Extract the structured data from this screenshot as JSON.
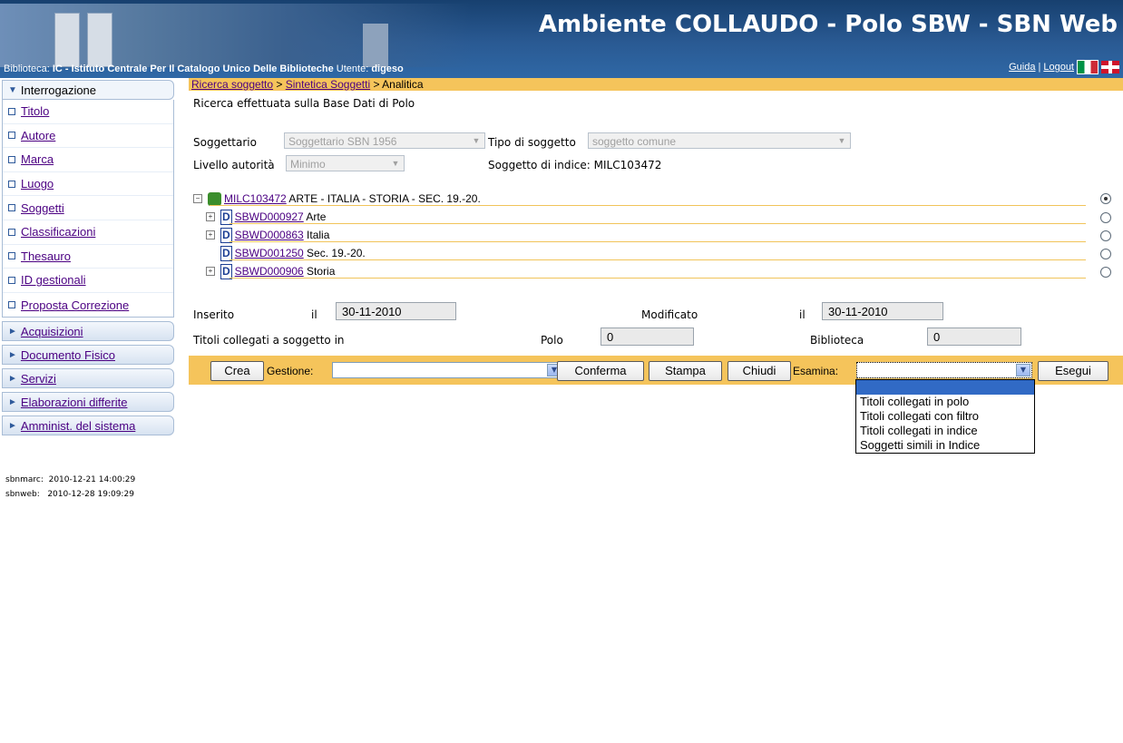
{
  "header": {
    "title": "Ambiente COLLAUDO - Polo SBW - SBN Web",
    "biblioteca_label": "Biblioteca:",
    "biblioteca_code": "IC",
    "biblioteca_name": " - Istituto Centrale Per Il Catalogo Unico Delle Biblioteche",
    "utente_label": "Utente:",
    "utente": "digeso",
    "guida": "Guida",
    "separator": "|",
    "logout": "Logout"
  },
  "sidebar": {
    "open_section": "Interrogazione",
    "items": [
      "Titolo",
      "Autore",
      "Marca",
      "Luogo",
      "Soggetti",
      "Classificazioni",
      "Thesauro",
      "ID gestionali",
      "Proposta Correzione"
    ],
    "sections": [
      "Acquisizioni",
      "Documento Fisico",
      "Servizi",
      "Elaborazioni differite",
      "Amminist. del sistema"
    ],
    "stamp_sbnmarc": "sbnmarc:  2010-12-21 14:00:29",
    "stamp_sbnweb": "sbnweb:   2010-12-28 19:09:29"
  },
  "breadcrumb": {
    "link1": "Ricerca soggetto",
    "sep1": " > ",
    "link2": "Sintetica Soggetti",
    "sep2": " > ",
    "current": "Analitica"
  },
  "form": {
    "search_info": "Ricerca effettuata sulla Base Dati di Polo",
    "soggettario_label": "Soggettario",
    "soggettario_value": "Soggettario SBN 1956",
    "tipo_label": "Tipo di soggetto",
    "tipo_value": "soggetto comune",
    "livello_label": "Livello autorità",
    "livello_value": "Minimo",
    "indice_text": "Soggetto di indice: MILC103472"
  },
  "tree": {
    "root": {
      "code": "MILC103472",
      "text": " ARTE - ITALIA - STORIA - SEC. 19.-20."
    },
    "children": [
      {
        "code": "SBWD000927",
        "text": " Arte",
        "expandable": true
      },
      {
        "code": "SBWD000863",
        "text": " Italia",
        "expandable": true
      },
      {
        "code": "SBWD001250",
        "text": " Sec. 19.-20.",
        "expandable": false
      },
      {
        "code": "SBWD000906",
        "text": " Storia",
        "expandable": true
      }
    ],
    "d_icon": "D"
  },
  "dates": {
    "inserito_label": "Inserito",
    "il": "il",
    "inserito_value": "30-11-2010",
    "modificato_label": "Modificato",
    "modificato_value": "30-11-2010"
  },
  "collegati": {
    "label": "Titoli collegati a soggetto in",
    "polo_label": "Polo",
    "polo_value": "0",
    "biblioteca_label": "Biblioteca",
    "biblioteca_value": "0"
  },
  "actions": {
    "crea": "Crea",
    "gestione_label": "Gestione:",
    "conferma": "Conferma",
    "stampa": "Stampa",
    "chiudi": "Chiudi",
    "esamina_label": "Esamina:",
    "esegui": "Esegui"
  },
  "esamina_options": [
    "",
    "Titoli collegati in polo",
    "Titoli collegati con filtro",
    "Titoli collegati in indice",
    "Soggetti simili in Indice"
  ],
  "colors": {
    "header_blue": "#2a5a93",
    "accent_yellow": "#f5c45b",
    "link_purple": "#4b0082",
    "selected_option": "#316ac5"
  }
}
